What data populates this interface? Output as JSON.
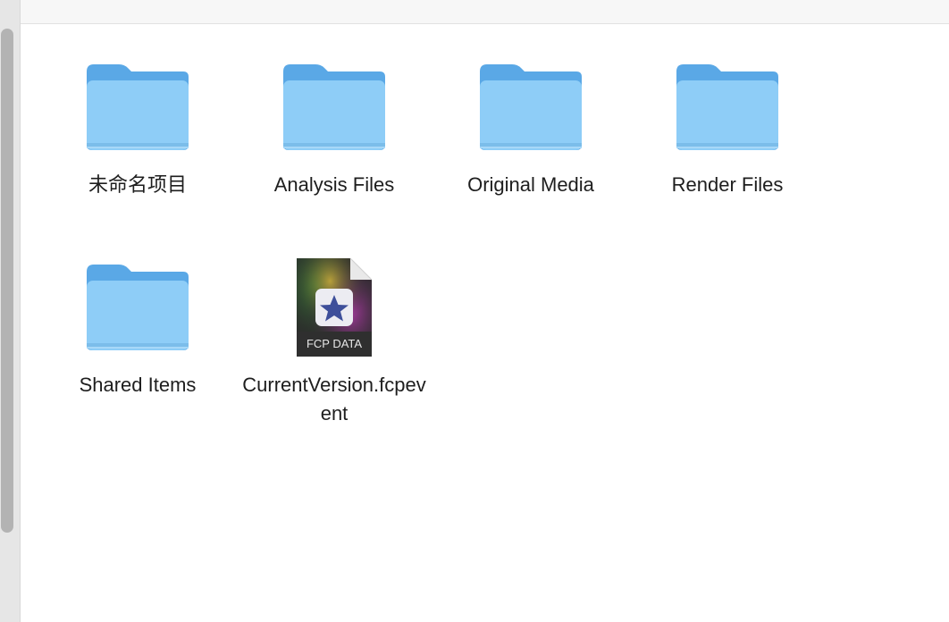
{
  "items": [
    {
      "name": "未命名项目",
      "kind": "folder",
      "icon": "folder-icon"
    },
    {
      "name": "Analysis Files",
      "kind": "folder",
      "icon": "folder-icon"
    },
    {
      "name": "Original Media",
      "kind": "folder",
      "icon": "folder-icon"
    },
    {
      "name": "Render Files",
      "kind": "folder",
      "icon": "folder-icon"
    },
    {
      "name": "Shared Items",
      "kind": "folder",
      "icon": "folder-icon"
    },
    {
      "name": "CurrentVersion.fcpevent",
      "kind": "file",
      "icon": "fcp-data-file-icon",
      "badge": "FCP DATA"
    }
  ],
  "colors": {
    "folder_front": "#8ecdf7",
    "folder_back": "#5aa8e6",
    "label_text": "#1e1e1e"
  }
}
